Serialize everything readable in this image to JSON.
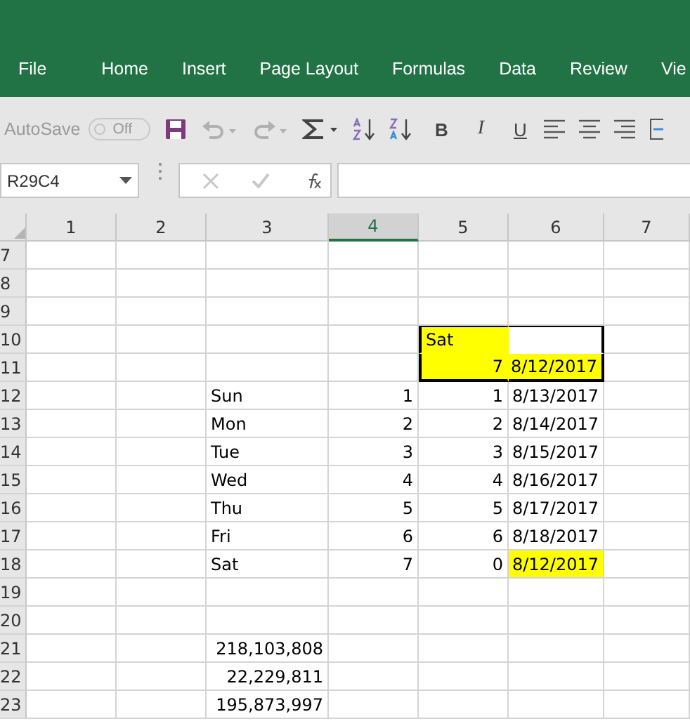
{
  "ribbon_tabs": [
    {
      "label": "File"
    },
    {
      "label": "Home"
    },
    {
      "label": "Insert"
    },
    {
      "label": "Page Layout"
    },
    {
      "label": "Formulas"
    },
    {
      "label": "Data"
    },
    {
      "label": "Review"
    },
    {
      "label": "Vie"
    }
  ],
  "toolbar": {
    "autosave": {
      "label": "AutoSave",
      "state": "Off",
      "on": false,
      "disabled": true
    },
    "format_buttons": [
      "B",
      "I",
      "U"
    ]
  },
  "name_box": {
    "value": "R29C4"
  },
  "columns": [
    {
      "label": "1",
      "selected": false
    },
    {
      "label": "2",
      "selected": false
    },
    {
      "label": "3",
      "selected": false
    },
    {
      "label": "4",
      "selected": true
    },
    {
      "label": "5",
      "selected": false
    },
    {
      "label": "6",
      "selected": false
    },
    {
      "label": "7",
      "selected": false
    }
  ],
  "rows": [
    {
      "header": "7",
      "cells": []
    },
    {
      "header": "8",
      "cells": []
    },
    {
      "header": "9",
      "cells": []
    },
    {
      "header": "10",
      "cells": [
        {
          "highlighted": false,
          "boxed": false
        },
        {
          "highlighted": false,
          "boxed": false
        },
        {
          "highlighted": false,
          "boxed": false
        },
        {
          "highlighted": false,
          "boxed": false
        },
        {
          "text": "Sat",
          "kind": "text",
          "highlighted": true,
          "boxed": true
        },
        {
          "highlighted": false,
          "boxed": true
        },
        {
          "highlighted": false,
          "boxed": false
        }
      ]
    },
    {
      "header": "11",
      "cells": [
        {
          "highlighted": false,
          "boxed": false
        },
        {
          "highlighted": false,
          "boxed": false
        },
        {
          "highlighted": false,
          "boxed": false
        },
        {
          "highlighted": false,
          "boxed": false
        },
        {
          "text": "7",
          "kind": "number",
          "highlighted": true,
          "boxed": true
        },
        {
          "text": "8/12/2017",
          "kind": "number",
          "highlighted": true,
          "boxed": true
        },
        {
          "highlighted": false,
          "boxed": false
        }
      ]
    },
    {
      "header": "12",
      "cells": [
        {
          "highlighted": false,
          "boxed": false
        },
        {
          "highlighted": false,
          "boxed": false
        },
        {
          "text": "Sun",
          "kind": "text",
          "highlighted": false,
          "boxed": false
        },
        {
          "text": "1",
          "kind": "number",
          "highlighted": false,
          "boxed": false
        },
        {
          "text": "1",
          "kind": "number",
          "highlighted": false,
          "boxed": false
        },
        {
          "text": "8/13/2017",
          "kind": "number",
          "highlighted": false,
          "boxed": false
        },
        {
          "highlighted": false,
          "boxed": false
        }
      ]
    },
    {
      "header": "13",
      "cells": [
        {
          "highlighted": false,
          "boxed": false
        },
        {
          "highlighted": false,
          "boxed": false
        },
        {
          "text": "Mon",
          "kind": "text",
          "highlighted": false,
          "boxed": false
        },
        {
          "text": "2",
          "kind": "number",
          "highlighted": false,
          "boxed": false
        },
        {
          "text": "2",
          "kind": "number",
          "highlighted": false,
          "boxed": false
        },
        {
          "text": "8/14/2017",
          "kind": "number",
          "highlighted": false,
          "boxed": false
        },
        {
          "highlighted": false,
          "boxed": false
        }
      ]
    },
    {
      "header": "14",
      "cells": [
        {
          "highlighted": false,
          "boxed": false
        },
        {
          "highlighted": false,
          "boxed": false
        },
        {
          "text": "Tue",
          "kind": "text",
          "highlighted": false,
          "boxed": false
        },
        {
          "text": "3",
          "kind": "number",
          "highlighted": false,
          "boxed": false
        },
        {
          "text": "3",
          "kind": "number",
          "highlighted": false,
          "boxed": false
        },
        {
          "text": "8/15/2017",
          "kind": "number",
          "highlighted": false,
          "boxed": false
        },
        {
          "highlighted": false,
          "boxed": false
        }
      ]
    },
    {
      "header": "15",
      "cells": [
        {
          "highlighted": false,
          "boxed": false
        },
        {
          "highlighted": false,
          "boxed": false
        },
        {
          "text": "Wed",
          "kind": "text",
          "highlighted": false,
          "boxed": false
        },
        {
          "text": "4",
          "kind": "number",
          "highlighted": false,
          "boxed": false
        },
        {
          "text": "4",
          "kind": "number",
          "highlighted": false,
          "boxed": false
        },
        {
          "text": "8/16/2017",
          "kind": "number",
          "highlighted": false,
          "boxed": false
        },
        {
          "highlighted": false,
          "boxed": false
        }
      ]
    },
    {
      "header": "16",
      "cells": [
        {
          "highlighted": false,
          "boxed": false
        },
        {
          "highlighted": false,
          "boxed": false
        },
        {
          "text": "Thu",
          "kind": "text",
          "highlighted": false,
          "boxed": false
        },
        {
          "text": "5",
          "kind": "number",
          "highlighted": false,
          "boxed": false
        },
        {
          "text": "5",
          "kind": "number",
          "highlighted": false,
          "boxed": false
        },
        {
          "text": "8/17/2017",
          "kind": "number",
          "highlighted": false,
          "boxed": false
        },
        {
          "highlighted": false,
          "boxed": false
        }
      ]
    },
    {
      "header": "17",
      "cells": [
        {
          "highlighted": false,
          "boxed": false
        },
        {
          "highlighted": false,
          "boxed": false
        },
        {
          "text": "Fri",
          "kind": "text",
          "highlighted": false,
          "boxed": false
        },
        {
          "text": "6",
          "kind": "number",
          "highlighted": false,
          "boxed": false
        },
        {
          "text": "6",
          "kind": "number",
          "highlighted": false,
          "boxed": false
        },
        {
          "text": "8/18/2017",
          "kind": "number",
          "highlighted": false,
          "boxed": false
        },
        {
          "highlighted": false,
          "boxed": false
        }
      ]
    },
    {
      "header": "18",
      "cells": [
        {
          "highlighted": false,
          "boxed": false
        },
        {
          "highlighted": false,
          "boxed": false
        },
        {
          "text": "Sat",
          "kind": "text",
          "highlighted": false,
          "boxed": false
        },
        {
          "text": "7",
          "kind": "number",
          "highlighted": false,
          "boxed": false
        },
        {
          "text": "0",
          "kind": "number",
          "highlighted": false,
          "boxed": false
        },
        {
          "text": "8/12/2017",
          "kind": "number",
          "highlighted": true,
          "boxed": false
        },
        {
          "highlighted": false,
          "boxed": false
        }
      ]
    },
    {
      "header": "19",
      "cells": []
    },
    {
      "header": "20",
      "cells": []
    },
    {
      "header": "21",
      "cells": [
        {
          "highlighted": false,
          "boxed": false
        },
        {
          "highlighted": false,
          "boxed": false
        },
        {
          "text": "218,103,808",
          "kind": "number",
          "highlighted": false,
          "boxed": false
        },
        {
          "highlighted": false,
          "boxed": false
        },
        {
          "highlighted": false,
          "boxed": false
        },
        {
          "highlighted": false,
          "boxed": false
        },
        {
          "highlighted": false,
          "boxed": false
        }
      ]
    },
    {
      "header": "22",
      "cells": [
        {
          "highlighted": false,
          "boxed": false
        },
        {
          "highlighted": false,
          "boxed": false
        },
        {
          "text": "22,229,811",
          "kind": "number",
          "highlighted": false,
          "boxed": false
        },
        {
          "highlighted": false,
          "boxed": false
        },
        {
          "highlighted": false,
          "boxed": false
        },
        {
          "highlighted": false,
          "boxed": false
        },
        {
          "highlighted": false,
          "boxed": false
        }
      ]
    },
    {
      "header": "23",
      "cells": [
        {
          "highlighted": false,
          "boxed": false
        },
        {
          "highlighted": false,
          "boxed": false
        },
        {
          "text": "195,873,997",
          "kind": "number",
          "highlighted": false,
          "boxed": false
        },
        {
          "highlighted": false,
          "boxed": false
        },
        {
          "highlighted": false,
          "boxed": false
        },
        {
          "highlighted": false,
          "boxed": false
        },
        {
          "highlighted": false,
          "boxed": false
        }
      ]
    }
  ]
}
